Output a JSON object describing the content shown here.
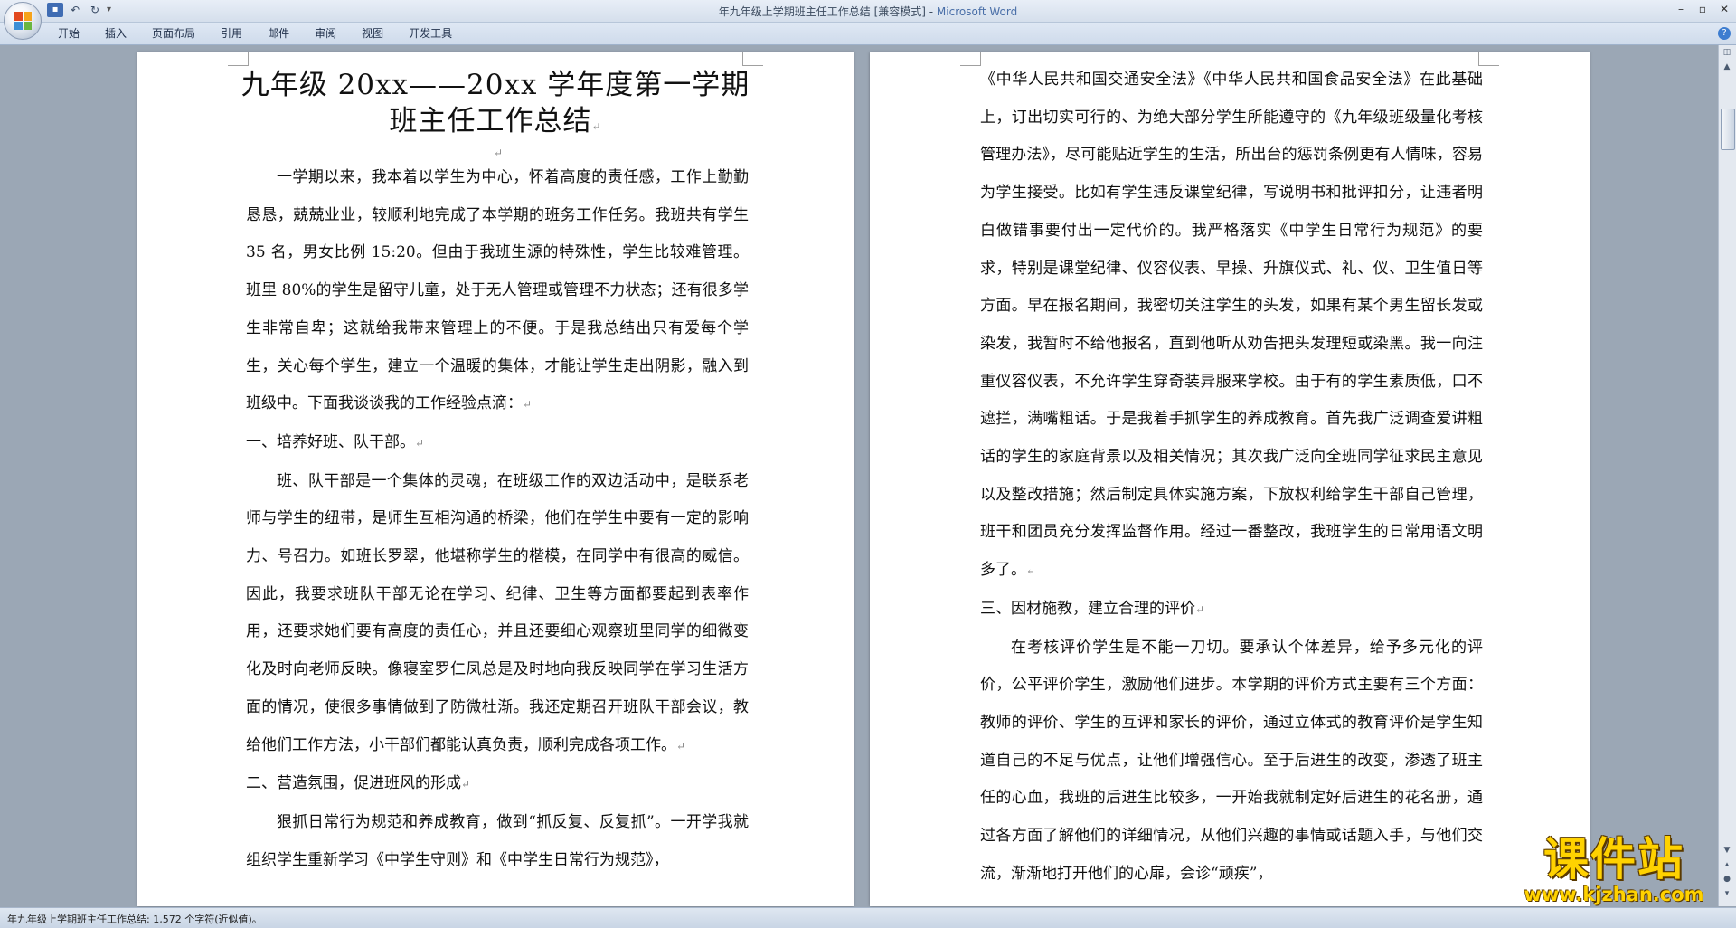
{
  "window": {
    "title_doc": "年九年级上学期班主任工作总结 [兼容模式] - ",
    "title_app": "Microsoft Word",
    "minimize": "–",
    "maximize": "▫",
    "close": "✕"
  },
  "quick_access": {
    "save": "▪",
    "undo": "↶",
    "redo": "↻",
    "dropdown": "▾"
  },
  "ribbon": {
    "tabs": [
      "开始",
      "插入",
      "页面布局",
      "引用",
      "邮件",
      "审阅",
      "视图",
      "开发工具"
    ],
    "help": "?"
  },
  "document": {
    "title_line1": "九年级 20xx——20xx 学年度第一学期",
    "title_line2": "班主任工作总结",
    "para_mark": "↵",
    "left_page": [
      {
        "style": "indent",
        "text": "一学期以来，我本着以学生为中心，怀着高度的责任感，工作上勤勤恳恳，兢兢业业，较顺利地完成了本学期的班务工作任务。我班共有学生 35 名，男女比例 15:20。但由于我班生源的特殊性，学生比较难管理。班里 80%的学生是留守儿童，处于无人管理或管理不力状态；还有很多学生非常自卑；这就给我带来管理上的不便。于是我总结出只有爱每个学生，关心每个学生，建立一个温暖的集体，才能让学生走出阴影，融入到班级中。下面我谈谈我的工作经验点滴："
      },
      {
        "style": "heading",
        "text": "一、培养好班、队干部。"
      },
      {
        "style": "indent",
        "text": "班、队干部是一个集体的灵魂，在班级工作的双边活动中，是联系老师与学生的纽带，是师生互相沟通的桥梁，他们在学生中要有一定的影响力、号召力。如班长罗翠，他堪称学生的楷模，在同学中有很高的威信。因此，我要求班队干部无论在学习、纪律、卫生等方面都要起到表率作用，还要求她们要有高度的责任心，并且还要细心观察班里同学的细微变化及时向老师反映。像寝室罗仁凤总是及时地向我反映同学在学习生活方面的情况，使很多事情做到了防微杜渐。我还定期召开班队干部会议，教给他们工作方法，小干部们都能认真负责，顺利完成各项工作。"
      },
      {
        "style": "heading",
        "text": "二、营造氛围，促进班风的形成"
      },
      {
        "style": "indent",
        "text": "狠抓日常行为规范和养成教育，做到“抓反复、反复抓”。一开学我就组织学生重新学习《中学生守则》和《中学生日常行为规范》，"
      }
    ],
    "right_page": [
      {
        "style": "plain",
        "text": "《中华人民共和国交通安全法》《中华人民共和国食品安全法》在此基础上，订出切实可行的、为绝大部分学生所能遵守的《九年级班级量化考核管理办法》，尽可能贴近学生的生活，所出台的惩罚条例更有人情味，容易为学生接受。比如有学生违反课堂纪律，写说明书和批评扣分，让违者明白做错事要付出一定代价的。我严格落实《中学生日常行为规范》的要求，特别是课堂纪律、仪容仪表、早操、升旗仪式、礼、仪、卫生值日等方面。早在报名期间，我密切关注学生的头发，如果有某个男生留长发或染发，我暂时不给他报名，直到他听从劝告把头发理短或染黑。我一向注重仪容仪表，不允许学生穿奇装异服来学校。由于有的学生素质低，口不遮拦，满嘴粗话。于是我着手抓学生的养成教育。首先我广泛调查爱讲粗话的学生的家庭背景以及相关情况；其次我广泛向全班同学征求民主意见以及整改措施；然后制定具体实施方案，下放权利给学生干部自己管理，班干和团员充分发挥监督作用。经过一番整改，我班学生的日常用语文明多了。"
      },
      {
        "style": "heading",
        "text": "三、因材施教，建立合理的评价"
      },
      {
        "style": "indent",
        "text": "在考核评价学生是不能一刀切。要承认个体差异，给予多元化的评价，公平评价学生，激励他们进步。本学期的评价方式主要有三个方面：教师的评价、学生的互评和家长的评价，通过立体式的教育评价是学生知道自己的不足与优点，让他们增强信心。至于后进生的改变，渗透了班主任的心血，我班的后进生比较多，一开始我就制定好后进生的花名册，通过各方面了解他们的详细情况，从他们兴趣的事情或话题入手，与他们交流，渐渐地打开他们的心扉，会诊“顽疾”，"
      }
    ]
  },
  "status_bar": {
    "text": "年九年级上学期班主任工作总结: 1,572 个字符(近似值)。"
  },
  "watermark": {
    "main": "课件站",
    "url": "www.kjzhan.com"
  }
}
